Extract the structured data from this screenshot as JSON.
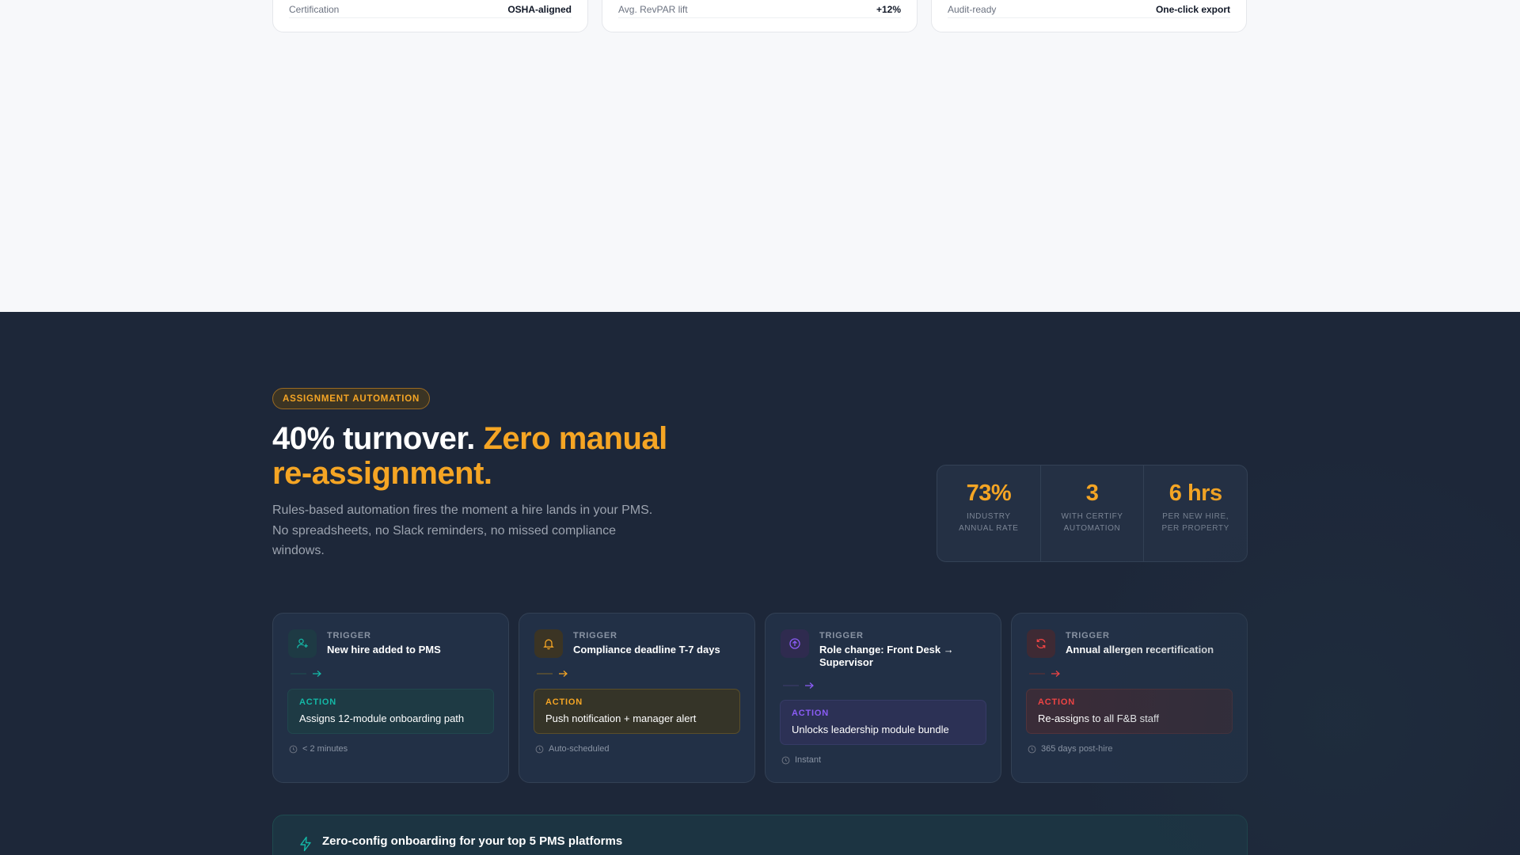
{
  "top_stats": [
    {
      "label": "Certification",
      "value": "OSHA-aligned"
    },
    {
      "label": "Avg. RevPAR lift",
      "value": "+12%"
    },
    {
      "label": "Audit-ready",
      "value": "One-click export"
    }
  ],
  "section": {
    "badge": "ASSIGNMENT AUTOMATION",
    "headline_white": "40% turnover. ",
    "headline_accent": "Zero manual re-assignment.",
    "subtext": "Rules-based automation fires the moment a hire lands in your PMS. No spreadsheets, no Slack reminders, no missed compliance windows."
  },
  "metrics": [
    {
      "value": "73%",
      "caption": "INDUSTRY ANNUAL RATE"
    },
    {
      "value": "3",
      "caption": "WITH CERTIFY AUTOMATION"
    },
    {
      "value": "6 hrs",
      "caption": "PER NEW HIRE, PER PROPERTY"
    }
  ],
  "flows": [
    {
      "icon": "user-plus-icon",
      "accent": "#14b8a6",
      "trigger_label": "TRIGGER",
      "trigger": "New hire added to PMS",
      "action_label": "ACTION",
      "action": "Assigns 12-module onboarding path",
      "timing": "< 2 minutes"
    },
    {
      "icon": "bell-icon",
      "accent": "#f5a524",
      "trigger_label": "TRIGGER",
      "trigger": "Compliance deadline T-7 days",
      "action_label": "ACTION",
      "action": "Push notification + manager alert",
      "timing": "Auto-scheduled"
    },
    {
      "icon": "arrow-up-circle-icon",
      "accent": "#8b5cf6",
      "trigger_label": "TRIGGER",
      "trigger": "Role change: Front Desk → Supervisor",
      "action_label": "ACTION",
      "action": "Unlocks leadership module bundle",
      "timing": "Instant"
    },
    {
      "icon": "refresh-icon",
      "accent": "#ef4444",
      "trigger_label": "TRIGGER",
      "trigger": "Annual allergen recertification",
      "action_label": "ACTION",
      "action": "Re-assigns to all F&B staff",
      "timing": "365 days post-hire"
    }
  ],
  "onboarding_banner": {
    "icon": "bolt-icon",
    "text": "Zero-config onboarding for your top 5 PMS platforms"
  }
}
